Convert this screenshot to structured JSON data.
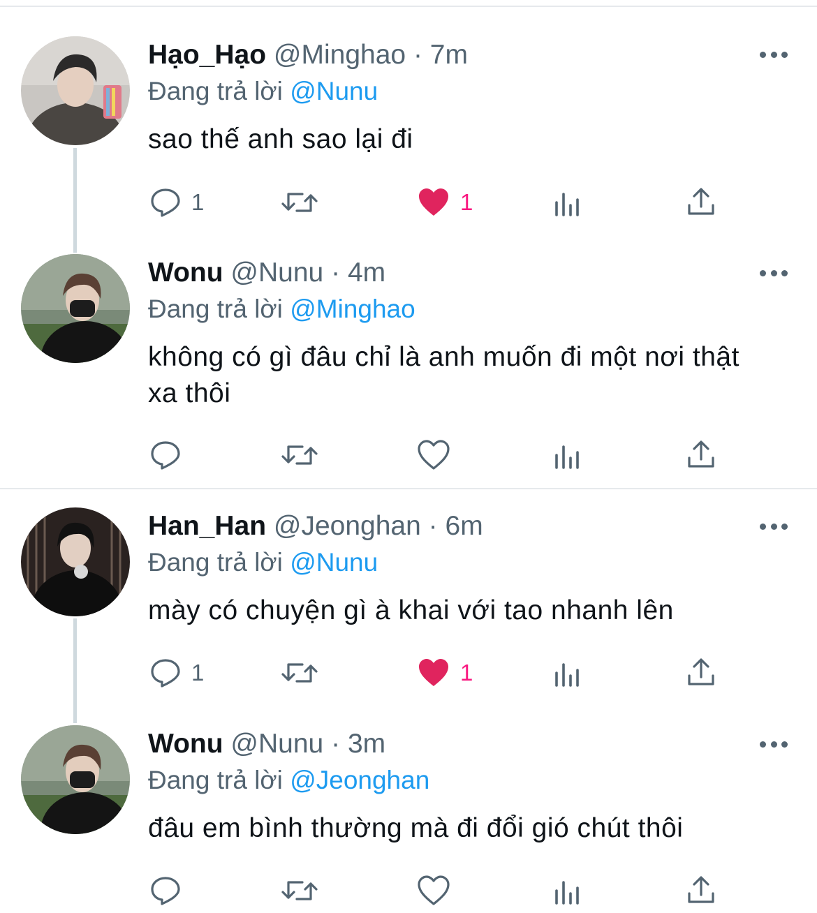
{
  "reply_prefix": "Đang trả lời",
  "colors": {
    "like": "#f91880",
    "mention": "#1d9bf0",
    "muted": "#536471"
  },
  "tweets": [
    {
      "name": "Hạo_Hạo",
      "handle": "@Minghao",
      "separator": "·",
      "time": "7m",
      "reply_to": "@Nunu",
      "text": "sao thế anh sao lại đi",
      "reply_count": "1",
      "retweet_count": "",
      "like_count": "1",
      "liked": true
    },
    {
      "name": "Wonu",
      "handle": "@Nunu",
      "separator": "·",
      "time": "4m",
      "reply_to": "@Minghao",
      "text": "không có gì đâu chỉ là anh muốn đi một nơi thật xa thôi",
      "reply_count": "",
      "retweet_count": "",
      "like_count": "",
      "liked": false
    },
    {
      "name": "Han_Han",
      "handle": "@Jeonghan",
      "separator": "·",
      "time": "6m",
      "reply_to": "@Nunu",
      "text": "mày có chuyện gì à khai với tao nhanh lên",
      "reply_count": "1",
      "retweet_count": "",
      "like_count": "1",
      "liked": true
    },
    {
      "name": "Wonu",
      "handle": "@Nunu",
      "separator": "·",
      "time": "3m",
      "reply_to": "@Jeonghan",
      "text": "đâu em bình thường mà đi đổi gió chút thôi",
      "reply_count": "",
      "retweet_count": "",
      "like_count": "",
      "liked": false
    }
  ]
}
